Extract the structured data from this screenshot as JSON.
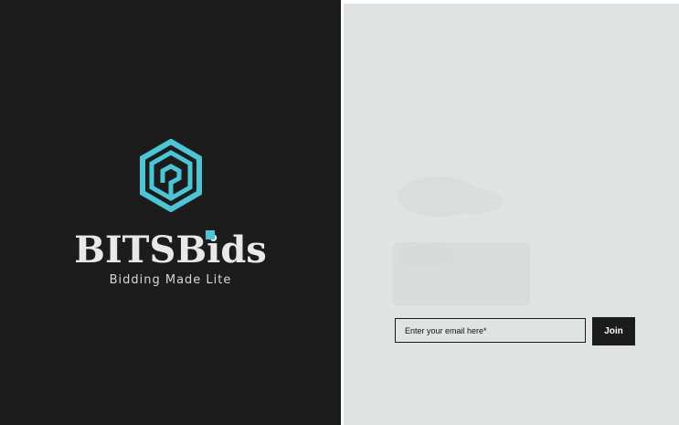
{
  "brand": {
    "name": "BITSBids",
    "tagline": "Bidding Made Lite",
    "accent_color": "#4cc6d6",
    "logo_icon": "hexagon-spiral-icon"
  },
  "signup": {
    "email_placeholder": "Enter your email here*",
    "email_value": "",
    "join_label": "Join"
  },
  "colors": {
    "left_background": "#1c1c1c",
    "right_background": "#dfe4e2",
    "button_background": "#1c1c1c"
  }
}
